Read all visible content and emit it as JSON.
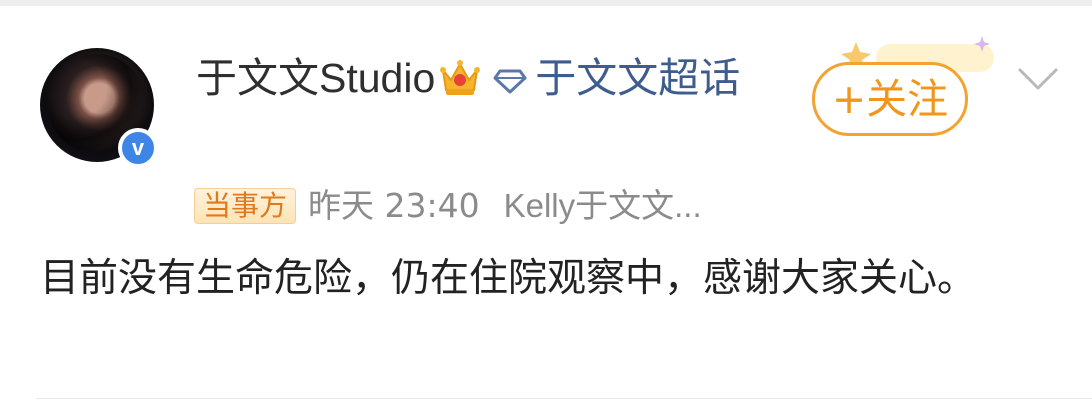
{
  "post": {
    "author": {
      "name": "于文文Studio",
      "topic_link": "于文文超话"
    },
    "follow_label": "+关注",
    "badge": "当事方",
    "time": "昨天 23:40",
    "source": "Kelly于文文...",
    "text": "目前没有生命危险，仍在住院观察中，感谢大家关心。"
  },
  "icons": {
    "verified": "verified-v-icon",
    "crown": "crown-icon",
    "diamond": "diamond-icon",
    "chevron": "chevron-down-icon"
  },
  "colors": {
    "follow_accent": "#f0961b",
    "topic_link": "#3e5c8e",
    "verified_blue": "#3d86e6",
    "meta_gray": "#8b8b8b"
  }
}
